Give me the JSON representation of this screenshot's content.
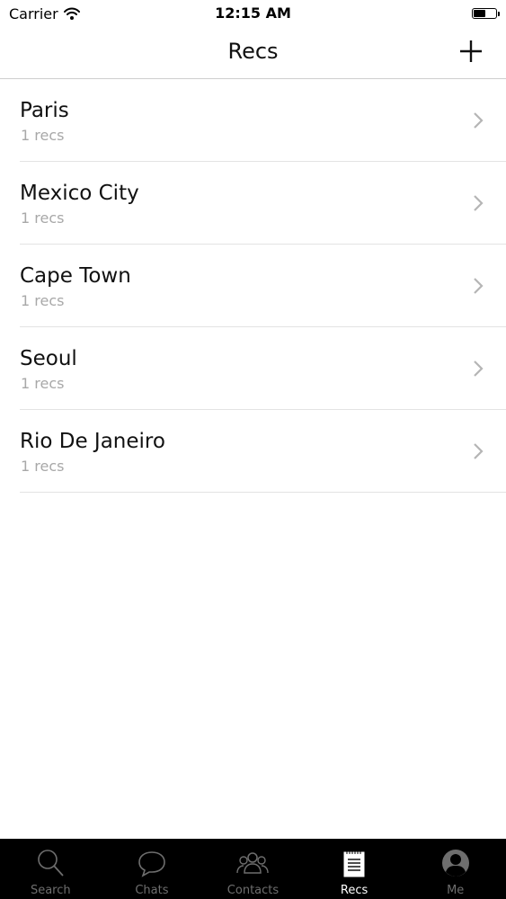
{
  "status_bar": {
    "carrier": "Carrier",
    "time": "12:15 AM",
    "battery_level": 0.5
  },
  "nav": {
    "title": "Recs",
    "add_icon": "plus-icon"
  },
  "list": {
    "items": [
      {
        "title": "Paris",
        "subtitle": "1 recs"
      },
      {
        "title": "Mexico City",
        "subtitle": "1 recs"
      },
      {
        "title": "Cape Town",
        "subtitle": "1 recs"
      },
      {
        "title": "Seoul",
        "subtitle": "1 recs"
      },
      {
        "title": "Rio De Janeiro",
        "subtitle": "1 recs"
      }
    ]
  },
  "tabs": [
    {
      "label": "Search",
      "icon": "search-icon"
    },
    {
      "label": "Chats",
      "icon": "chat-bubble-icon"
    },
    {
      "label": "Contacts",
      "icon": "contacts-icon"
    },
    {
      "label": "Recs",
      "icon": "notepad-icon",
      "active": true
    },
    {
      "label": "Me",
      "icon": "profile-icon"
    }
  ],
  "colors": {
    "tab_bar_bg": "#000000",
    "tab_inactive": "#6e6e6e",
    "tab_active": "#ffffff",
    "subtitle": "#a8a8a8",
    "separator": "#e3e3e3"
  }
}
